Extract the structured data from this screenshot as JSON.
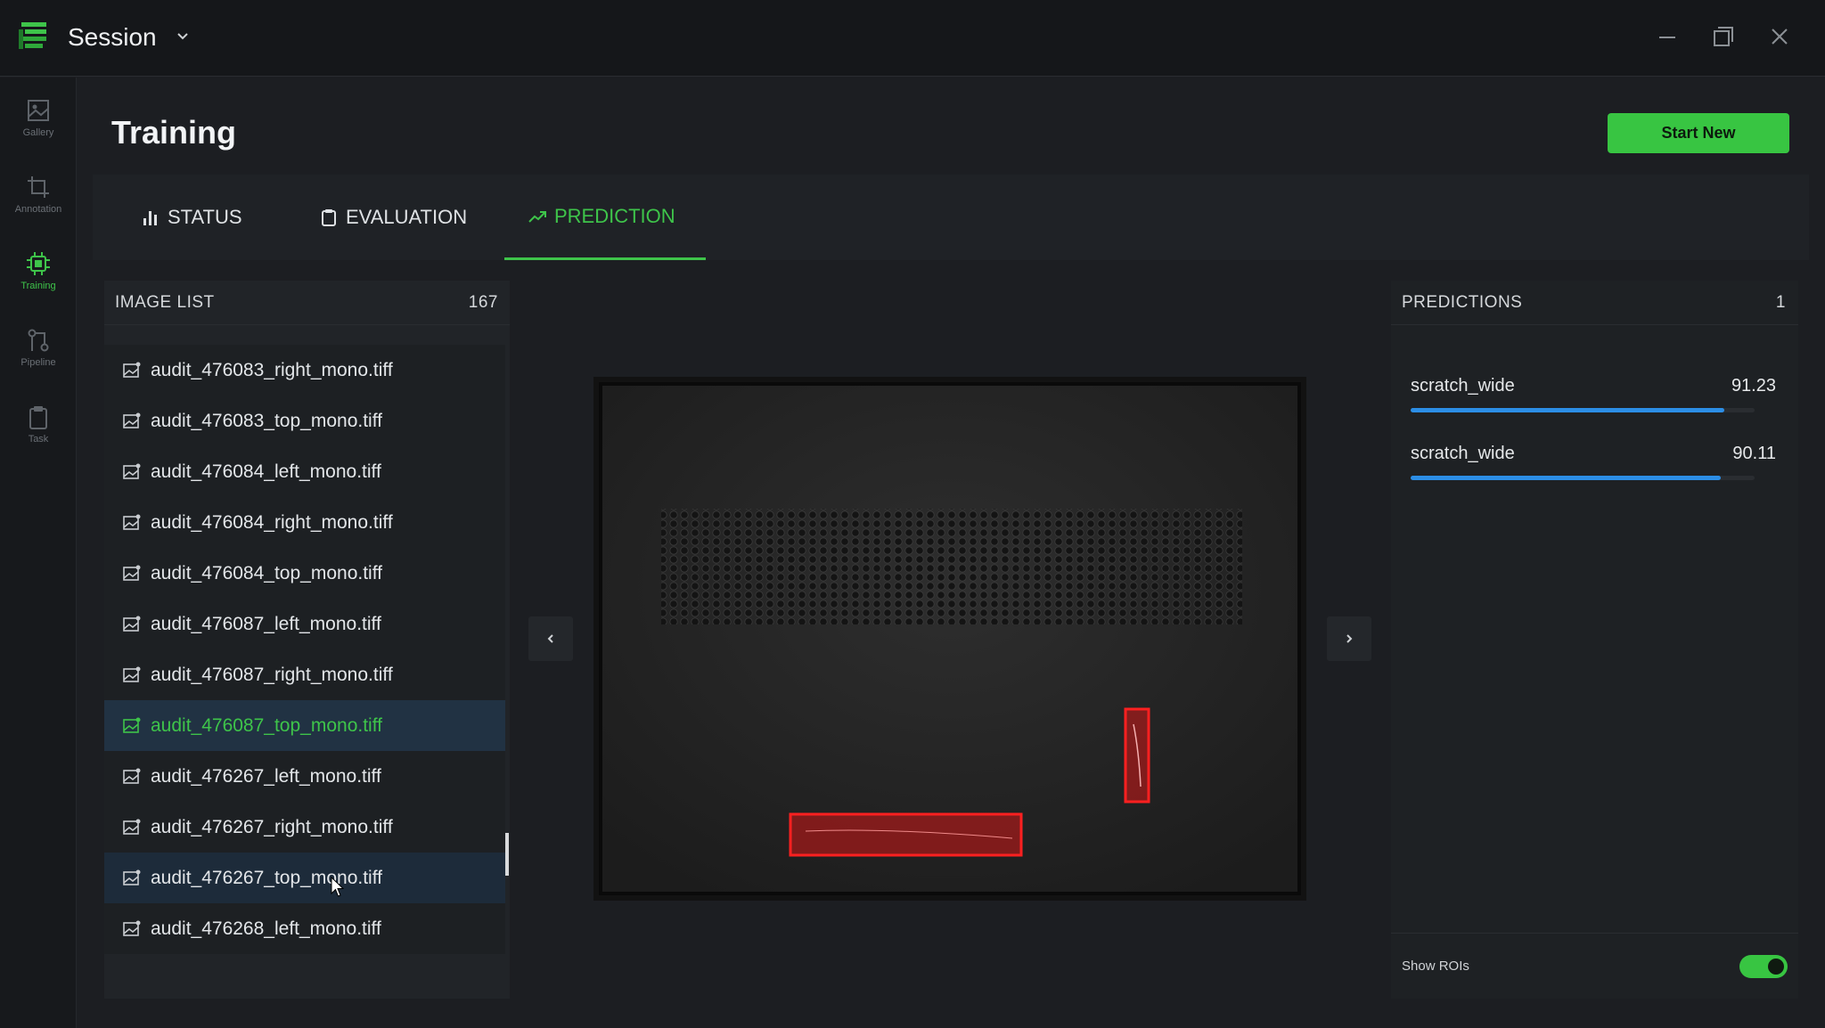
{
  "app": {
    "title": "Session",
    "logo_icon": "session-logo-icon",
    "window_controls": [
      "minimize-icon",
      "restore-icon",
      "close-icon"
    ]
  },
  "sidebar": {
    "items": [
      {
        "label": "Gallery",
        "icon": "gallery-icon",
        "active": false
      },
      {
        "label": "Annotation",
        "icon": "crop-icon",
        "active": false
      },
      {
        "label": "Training",
        "icon": "chip-icon",
        "active": true
      },
      {
        "label": "Pipeline",
        "icon": "pipeline-icon",
        "active": false
      },
      {
        "label": "Task",
        "icon": "clipboard-icon",
        "active": false
      }
    ]
  },
  "header": {
    "title": "Training",
    "start_button": "Start New"
  },
  "tabs": [
    {
      "label": "STATUS",
      "icon": "bar-chart-icon",
      "active": false
    },
    {
      "label": "EVALUATION",
      "icon": "clipboard-icon",
      "active": false
    },
    {
      "label": "PREDICTION",
      "icon": "trend-up-icon",
      "active": true
    }
  ],
  "image_list": {
    "title": "IMAGE LIST",
    "count": "167",
    "items": [
      "audit_476083_right_mono.tiff",
      "audit_476083_top_mono.tiff",
      "audit_476084_left_mono.tiff",
      "audit_476084_right_mono.tiff",
      "audit_476084_top_mono.tiff",
      "audit_476087_left_mono.tiff",
      "audit_476087_right_mono.tiff",
      "audit_476087_top_mono.tiff",
      "audit_476267_left_mono.tiff",
      "audit_476267_right_mono.tiff",
      "audit_476267_top_mono.tiff",
      "audit_476268_left_mono.tiff"
    ],
    "selected_index": 7,
    "hovered_index": 10
  },
  "predictions": {
    "title": "PREDICTIONS",
    "count": "1",
    "items": [
      {
        "label": "scratch_wide",
        "score": "91.23",
        "fraction": 0.9123
      },
      {
        "label": "scratch_wide",
        "score": "90.11",
        "fraction": 0.9011
      }
    ],
    "show_rois_label": "Show ROIs",
    "show_rois": true
  },
  "colors": {
    "accent": "#3ec44a",
    "bar": "#2c8ee6",
    "roi": "#e01b1b"
  }
}
